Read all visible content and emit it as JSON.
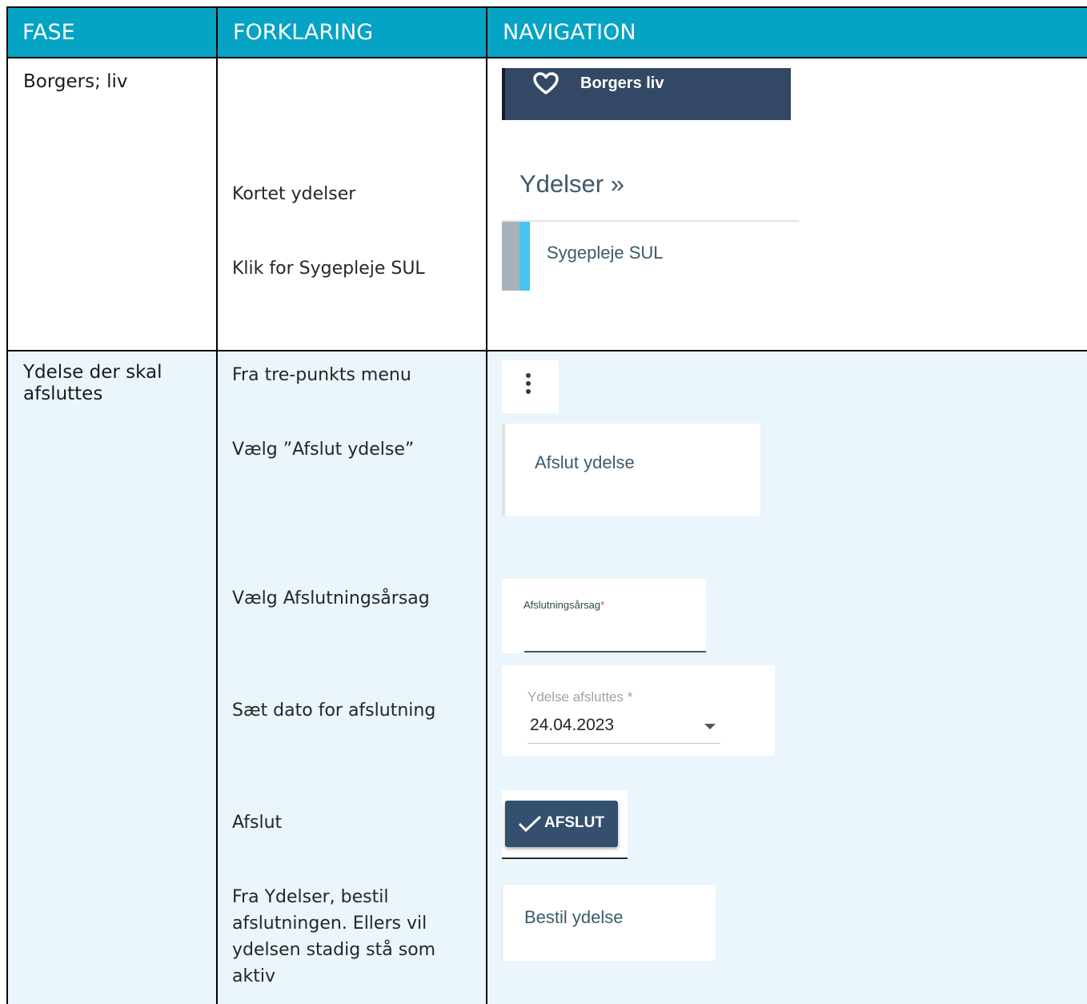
{
  "header": {
    "fase": "FASE",
    "forklaring": "FORKLARING",
    "navigation": "NAVIGATION"
  },
  "rows": [
    {
      "fase": "Borgers; liv",
      "steps": [
        "Kortet ydelser",
        "Klik for Sygepleje SUL"
      ]
    },
    {
      "fase_line1": "Ydelse der skal",
      "fase_line2": "afsluttes",
      "steps": [
        "Fra tre-punkts menu",
        "Vælg ”Afslut ydelse”",
        "Vælg Afslutningsårsag",
        "Sæt dato for afslutning",
        "Afslut",
        "Fra Ydelser, bestil",
        "afslutningen. Ellers vil",
        "ydelsen stadig stå som",
        "aktiv"
      ]
    }
  ],
  "nav": {
    "borgers_liv": "Borgers liv",
    "ydelser_title": "Ydelser »",
    "sygepleje": "Sygepleje SUL",
    "afslut_ydelse": "Afslut ydelse",
    "aarsag_label": "Afslutningsårsag",
    "required_mark": "*",
    "dato_label": "Ydelse afsluttes *",
    "dato_value": "24.04.2023",
    "afslut_button": "AFSLUT",
    "bestil_ydelse": "Bestil ydelse"
  },
  "colors": {
    "header_bg": "#05a3c4",
    "row2_bg": "#eaf5fc",
    "nav_dark": "#324864",
    "accent_blue": "#47c4f2"
  }
}
